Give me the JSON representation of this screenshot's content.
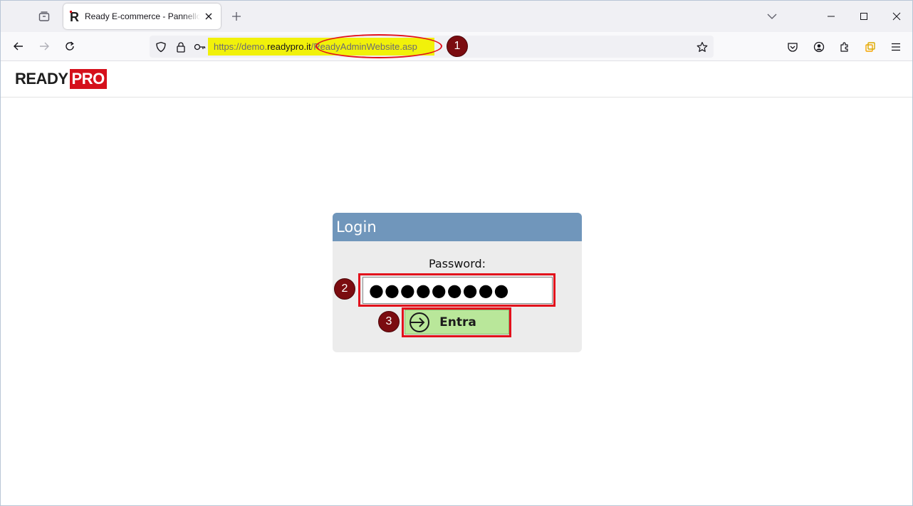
{
  "browser": {
    "tab_title": "Ready E-commerce - Pannello di amministrazione",
    "url": {
      "prefix": "https://demo.",
      "domain": "readypro.it",
      "path": "/ReadyAdminWebsite.asp"
    }
  },
  "annotations": {
    "marker_1": "1",
    "marker_2": "2",
    "marker_3": "3",
    "highlight_color": "#f1f10a",
    "frame_color": "#e2111c"
  },
  "page": {
    "logo": {
      "part1": "READY",
      "part2": "PRO",
      "accent": "#d5101b"
    },
    "login": {
      "title": "Login",
      "password_label": "Password:",
      "password_value": "●●●●●●●●●",
      "submit_label": "Entra",
      "header_color": "#7096bb",
      "button_color": "#b9e79a"
    }
  },
  "icons": [
    "tab-list-icon",
    "readypro-favicon",
    "close-icon",
    "plus-icon",
    "chevron-down-icon",
    "minimize-icon",
    "maximize-icon",
    "window-close-icon",
    "back-icon",
    "forward-icon",
    "reload-icon",
    "shield-icon",
    "lock-icon",
    "key-icon",
    "star-icon",
    "pocket-icon",
    "account-icon",
    "extensions-icon",
    "multi-account-icon",
    "menu-icon",
    "login-arrow-icon"
  ]
}
